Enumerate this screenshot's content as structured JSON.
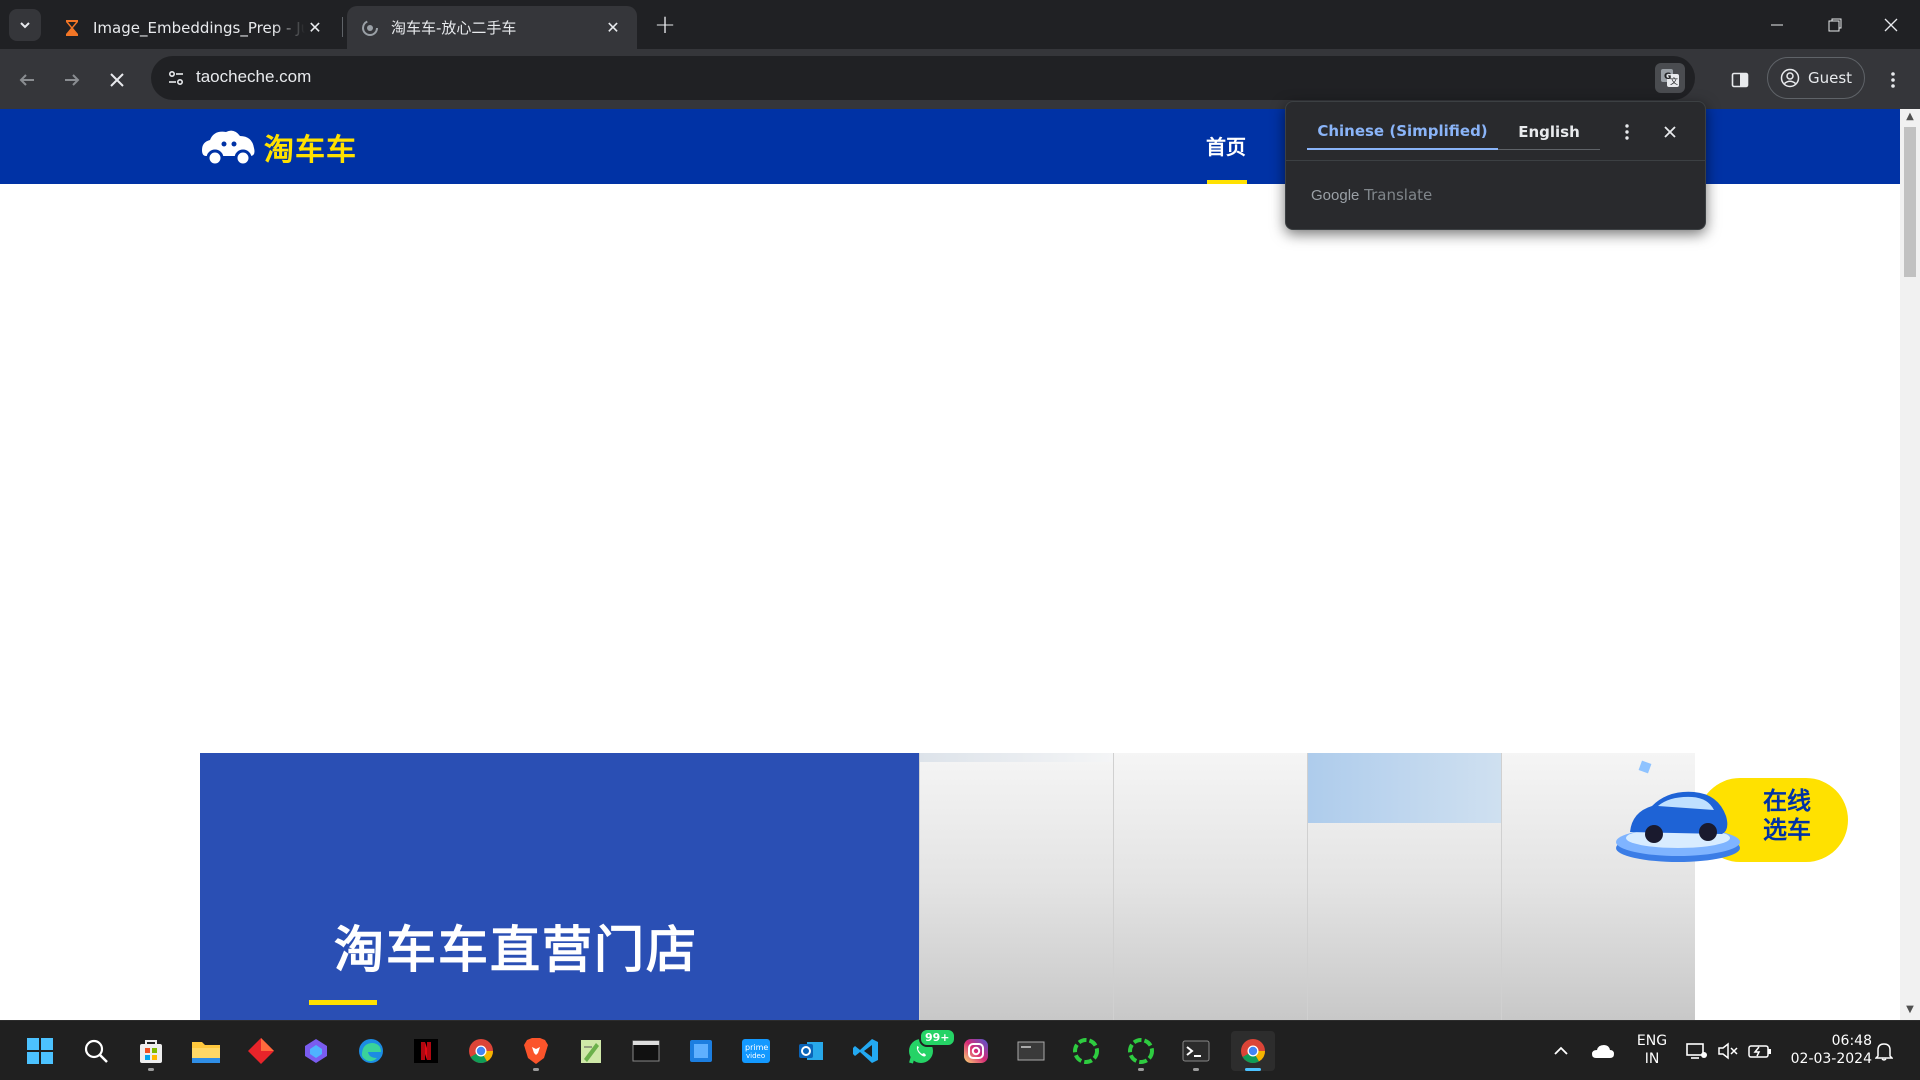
{
  "browser": {
    "tabs": [
      {
        "title": "Image_Embeddings_Prep - Jupyter",
        "active": false,
        "favicon": "hourglass-icon"
      },
      {
        "title": "淘车车-放心二手车",
        "active": true,
        "favicon": "loading-spinner-icon"
      }
    ],
    "url": "taocheche.com",
    "profile_label": "Guest"
  },
  "translate_popup": {
    "source_language": "Chinese (Simplified)",
    "target_language": "English",
    "brand_google": "Google",
    "brand_translate": "Translate"
  },
  "site": {
    "logo_text": "淘车车",
    "nav": {
      "home": "首页"
    },
    "banner_title": "淘车车直营门店",
    "float_button_line1": "在线",
    "float_button_line2": "选车",
    "colors": {
      "header": "#0032a5",
      "accent": "#ffe100",
      "banner": "#2a4fb4"
    }
  },
  "taskbar": {
    "apps": [
      "start",
      "search",
      "microsoft-store",
      "file-explorer",
      "app-red",
      "copilot",
      "edge",
      "netflix",
      "chrome",
      "brave",
      "notepad-plus",
      "terminal-window",
      "app-blue",
      "prime-video",
      "outlook",
      "vscode",
      "whatsapp",
      "instagram",
      "window-app",
      "spinner-app-1",
      "spinner-app-2",
      "powershell",
      "chrome-active"
    ],
    "whatsapp_badge": "99+",
    "language_line1": "ENG",
    "language_line2": "IN",
    "time": "06:48",
    "date": "02-03-2024"
  }
}
